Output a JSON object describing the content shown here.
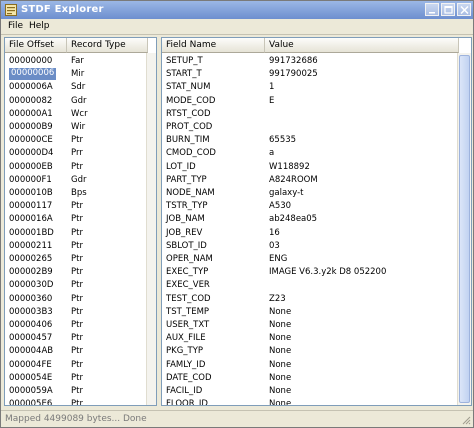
{
  "window": {
    "title": "STDF Explorer"
  },
  "menu": {
    "items": [
      "File",
      "Help"
    ]
  },
  "records": {
    "headers": [
      "File Offset",
      "Record Type"
    ],
    "selected_index": 1,
    "rows": [
      [
        "00000000",
        "Far"
      ],
      [
        "00000006",
        "Mir"
      ],
      [
        "0000006A",
        "Sdr"
      ],
      [
        "00000082",
        "Gdr"
      ],
      [
        "000000A1",
        "Wcr"
      ],
      [
        "000000B9",
        "Wir"
      ],
      [
        "000000CE",
        "Ptr"
      ],
      [
        "000000D4",
        "Prr"
      ],
      [
        "000000EB",
        "Ptr"
      ],
      [
        "000000F1",
        "Gdr"
      ],
      [
        "0000010B",
        "Bps"
      ],
      [
        "00000117",
        "Ptr"
      ],
      [
        "0000016A",
        "Ptr"
      ],
      [
        "000001BD",
        "Ptr"
      ],
      [
        "00000211",
        "Ptr"
      ],
      [
        "00000265",
        "Ptr"
      ],
      [
        "000002B9",
        "Ptr"
      ],
      [
        "0000030D",
        "Ptr"
      ],
      [
        "00000360",
        "Ptr"
      ],
      [
        "000003B3",
        "Ptr"
      ],
      [
        "00000406",
        "Ptr"
      ],
      [
        "00000457",
        "Ptr"
      ],
      [
        "000004AB",
        "Ptr"
      ],
      [
        "000004FE",
        "Ptr"
      ],
      [
        "0000054E",
        "Ptr"
      ],
      [
        "0000059A",
        "Ptr"
      ],
      [
        "000005E6",
        "Ptr"
      ]
    ]
  },
  "fields": {
    "headers": [
      "Field Name",
      "Value"
    ],
    "rows": [
      [
        "SETUP_T",
        "991732686"
      ],
      [
        "START_T",
        "991790025"
      ],
      [
        "STAT_NUM",
        "1"
      ],
      [
        "MODE_COD",
        "E"
      ],
      [
        "RTST_COD",
        ""
      ],
      [
        "PROT_COD",
        ""
      ],
      [
        "BURN_TIM",
        "65535"
      ],
      [
        "CMOD_COD",
        "a"
      ],
      [
        "LOT_ID",
        "W118892"
      ],
      [
        "PART_TYP",
        "A824ROOM"
      ],
      [
        "NODE_NAM",
        "galaxy-t"
      ],
      [
        "TSTR_TYP",
        "A530"
      ],
      [
        "JOB_NAM",
        "ab248ea05"
      ],
      [
        "JOB_REV",
        "16"
      ],
      [
        "SBLOT_ID",
        "03"
      ],
      [
        "OPER_NAM",
        "ENG"
      ],
      [
        "EXEC_TYP",
        "IMAGE V6.3.y2k D8 052200"
      ],
      [
        "EXEC_VER",
        ""
      ],
      [
        "TEST_COD",
        "Z23"
      ],
      [
        "TST_TEMP",
        "None"
      ],
      [
        "USER_TXT",
        "None"
      ],
      [
        "AUX_FILE",
        "None"
      ],
      [
        "PKG_TYP",
        "None"
      ],
      [
        "FAMLY_ID",
        "None"
      ],
      [
        "DATE_COD",
        "None"
      ],
      [
        "FACIL_ID",
        "None"
      ],
      [
        "FLOOR_ID",
        "None"
      ]
    ]
  },
  "status": {
    "text": "Mapped 4499089 bytes... Done"
  }
}
